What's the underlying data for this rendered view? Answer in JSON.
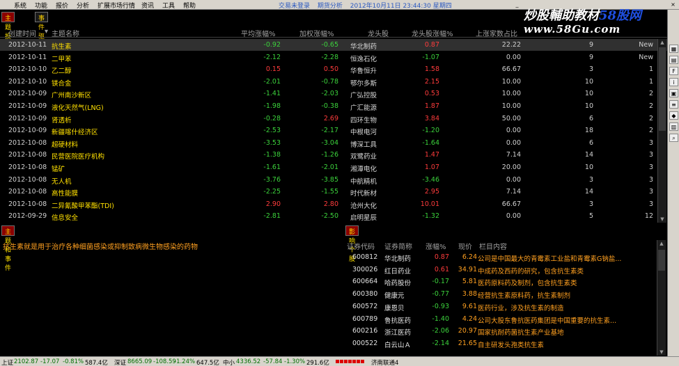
{
  "menu": [
    "系统",
    "功能",
    "报价",
    "分析",
    "扩展市场行情",
    "资讯",
    "工具",
    "帮助"
  ],
  "notice": {
    "login": "交易未登录",
    "analysis": "期货分析",
    "datetime": "2012年10月11日 23:44:30 星期四"
  },
  "brand": {
    "title": "炒股輔助教材",
    "accent": "58股网",
    "url": "www.58Gu.com"
  },
  "tabs": [
    "主题投资",
    "事件驱动"
  ],
  "table": {
    "headers": [
      "创建时间",
      "主题名称",
      "平均涨幅%",
      "加权涨幅%",
      "龙头股",
      "龙头股涨幅%",
      "上涨家数占比"
    ],
    "rows": [
      {
        "date": "2012-10-11",
        "name": "抗生素",
        "avg": "-0.92",
        "wavg": "-0.65",
        "lead": "华北制药",
        "lpct": "0.87",
        "lcnt": "22.22",
        "n1": "9",
        "n2": "New"
      },
      {
        "date": "2012-10-11",
        "name": "二甲苯",
        "avg": "-2.12",
        "wavg": "-2.28",
        "lead": "恒逸石化",
        "lpct": "-1.07",
        "lcnt": "0.00",
        "n1": "9",
        "n2": "New"
      },
      {
        "date": "2012-10-10",
        "name": "乙二醇",
        "avg": "0.15",
        "wavg": "0.50",
        "lead": "华鲁恒升",
        "lpct": "1.58",
        "lcnt": "66.67",
        "n1": "3",
        "n2": "1"
      },
      {
        "date": "2012-10-10",
        "name": "镁合金",
        "avg": "-2.01",
        "wavg": "-0.78",
        "lead": "鄂尔多斯",
        "lpct": "2.15",
        "lcnt": "10.00",
        "n1": "10",
        "n2": "1"
      },
      {
        "date": "2012-10-09",
        "name": "广州南沙新区",
        "avg": "-1.41",
        "wavg": "-2.03",
        "lead": "广弘控股",
        "lpct": "0.53",
        "lcnt": "10.00",
        "n1": "10",
        "n2": "2"
      },
      {
        "date": "2012-10-09",
        "name": "液化天然气(LNG)",
        "avg": "-1.98",
        "wavg": "-0.38",
        "lead": "广汇能源",
        "lpct": "1.87",
        "lcnt": "10.00",
        "n1": "10",
        "n2": "2"
      },
      {
        "date": "2012-10-09",
        "name": "肾透析",
        "avg": "-0.28",
        "wavg": "2.69",
        "lead": "四环生物",
        "lpct": "3.84",
        "lcnt": "50.00",
        "n1": "6",
        "n2": "2"
      },
      {
        "date": "2012-10-09",
        "name": "新疆喀什经济区",
        "avg": "-2.53",
        "wavg": "-2.17",
        "lead": "中根电河",
        "lpct": "-1.20",
        "lcnt": "0.00",
        "n1": "18",
        "n2": "2"
      },
      {
        "date": "2012-10-08",
        "name": "超硬材料",
        "avg": "-3.53",
        "wavg": "-3.04",
        "lead": "博深工具",
        "lpct": "-1.64",
        "lcnt": "0.00",
        "n1": "6",
        "n2": "3"
      },
      {
        "date": "2012-10-08",
        "name": "民营医院医疗机构",
        "avg": "-1.38",
        "wavg": "-1.26",
        "lead": "双鹭药业",
        "lpct": "1.47",
        "lcnt": "7.14",
        "n1": "14",
        "n2": "3"
      },
      {
        "date": "2012-10-08",
        "name": "锰矿",
        "avg": "-1.61",
        "wavg": "-2.01",
        "lead": "湘潭电化",
        "lpct": "1.07",
        "lcnt": "20.00",
        "n1": "10",
        "n2": "3"
      },
      {
        "date": "2012-10-08",
        "name": "无人机",
        "avg": "-3.76",
        "wavg": "-3.85",
        "lead": "中航精机",
        "lpct": "-3.46",
        "lcnt": "0.00",
        "n1": "3",
        "n2": "3"
      },
      {
        "date": "2012-10-08",
        "name": "高性能膜",
        "avg": "-2.25",
        "wavg": "-1.55",
        "lead": "时代新材",
        "lpct": "2.95",
        "lcnt": "7.14",
        "n1": "14",
        "n2": "3"
      },
      {
        "date": "2012-10-08",
        "name": "二异氰酸甲苯酯(TDI)",
        "avg": "2.90",
        "wavg": "2.80",
        "lead": "沧州大化",
        "lpct": "10.01",
        "lcnt": "66.67",
        "n1": "3",
        "n2": "3"
      },
      {
        "date": "2012-09-29",
        "name": "信息安全",
        "avg": "-2.81",
        "wavg": "-2.50",
        "lead": "启明星辰",
        "lpct": "-1.32",
        "lcnt": "0.00",
        "n1": "5",
        "n2": "12"
      }
    ]
  },
  "lower_tabs": {
    "left": "主题和事件",
    "right": "影响个股"
  },
  "topic_desc": "抗生素就是用于治疗各种细菌感染或抑制致病微生物感染的药物",
  "stocks": {
    "headers": [
      "证券代码",
      "证券简称",
      "涨幅%",
      "现价",
      "栏目内容"
    ],
    "rows": [
      {
        "code": "600812",
        "name": "华北制药",
        "pct": "0.87",
        "price": "6.24",
        "col": "公司是中国最大的青霉素工业盐和青霉素G钠盐..."
      },
      {
        "code": "300026",
        "name": "红日药业",
        "pct": "0.61",
        "price": "34.91",
        "col": "中成药及西药的研究，包含抗生素类"
      },
      {
        "code": "600664",
        "name": "哈药股份",
        "pct": "-0.17",
        "price": "5.81",
        "col": "医药原料药及制剂，包含抗生素类"
      },
      {
        "code": "600380",
        "name": "健康元",
        "pct": "-0.77",
        "price": "3.88",
        "col": "经营抗生素原料药，抗生素制剂"
      },
      {
        "code": "600572",
        "name": "康恩贝",
        "pct": "-0.93",
        "price": "9.61",
        "col": "医药行业，涉及抗生素的制造"
      },
      {
        "code": "600789",
        "name": "鲁抗医药",
        "pct": "-1.40",
        "price": "4.24",
        "col": "公司大股东鲁抗医药集团是中国重要的抗生素..."
      },
      {
        "code": "600216",
        "name": "浙江医药",
        "pct": "-2.06",
        "price": "20.97",
        "col": "国家抗耐药菌抗生素产业基地"
      },
      {
        "code": "000522",
        "name": "白云山Ａ",
        "pct": "-2.14",
        "price": "21.65",
        "col": "自主研发头孢类抗生素"
      }
    ]
  },
  "status": {
    "sh_label": "上证",
    "sh_val": "2102.87",
    "sh_chg": "-17.07",
    "sh_pct": "-0.81%",
    "sh_amt": "587.4亿",
    "sz_label": "深证",
    "sz_val": "8665.09",
    "sz_chg": "-108.59",
    "sz_pct": "-1.24%",
    "sz_amt": "647.5亿",
    "zx_label": "中小",
    "zx_val": "4336.52",
    "zx_chg": "-57.84",
    "zx_pct": "-1.30%",
    "zx_amt": "291.6亿",
    "net": "济南联通4"
  }
}
